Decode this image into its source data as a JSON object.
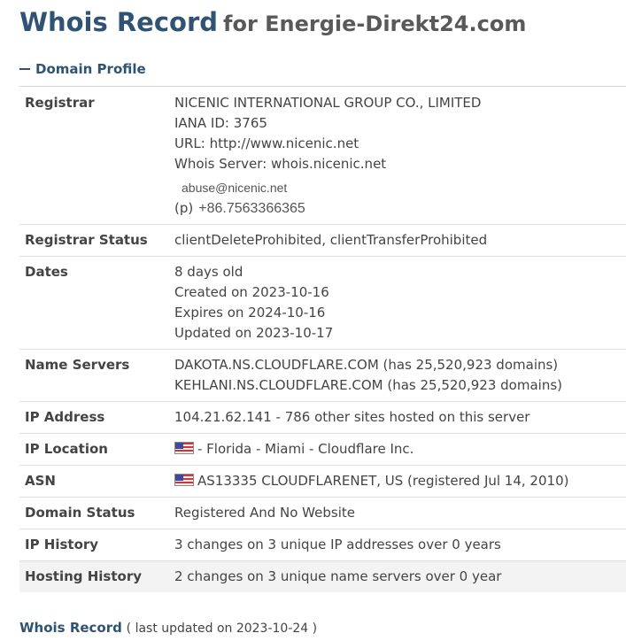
{
  "page": {
    "title_main": "Whois Record",
    "title_sub": "for Energie-Direkt24.com"
  },
  "section": {
    "label": "Domain Profile"
  },
  "registrar": {
    "label": "Registrar",
    "name": "NICENIC INTERNATIONAL GROUP CO., LIMITED",
    "iana": "IANA ID: 3765",
    "url": "URL: http://www.nicenic.net",
    "whois_server": "Whois Server: whois.nicenic.net",
    "email": "abuse@nicenic.net",
    "phone_prefix": "(p)",
    "phone": "+86.7563366365"
  },
  "registrar_status": {
    "label": "Registrar Status",
    "value": "clientDeleteProhibited, clientTransferProhibited"
  },
  "dates": {
    "label": "Dates",
    "age": "8 days old",
    "created": "Created on 2023-10-16",
    "expires": "Expires on 2024-10-16",
    "updated": "Updated on 2023-10-17"
  },
  "name_servers": {
    "label": "Name Servers",
    "ns1": "DAKOTA.NS.CLOUDFLARE.COM (has 25,520,923 domains)",
    "ns2": "KEHLANI.NS.CLOUDFLARE.COM (has 25,520,923 domains)"
  },
  "ip_address": {
    "label": "IP Address",
    "value": "104.21.62.141 - 786 other sites hosted on this server"
  },
  "ip_location": {
    "label": "IP Location",
    "flag_icon": "us-flag-icon",
    "value": "- Florida - Miami - Cloudflare Inc."
  },
  "asn": {
    "label": "ASN",
    "flag_icon": "us-flag-icon",
    "value": "AS13335 CLOUDFLARENET, US (registered Jul 14, 2010)"
  },
  "domain_status": {
    "label": "Domain Status",
    "value": "Registered And No Website"
  },
  "ip_history": {
    "label": "IP History",
    "value": "3 changes on 3 unique IP addresses over 0 years"
  },
  "hosting_history": {
    "label": "Hosting History",
    "value": "2 changes on 3 unique name servers over 0 year"
  },
  "footer": {
    "link": "Whois Record",
    "note": "( last updated on 2023-10-24 )"
  },
  "colors": {
    "title_blue": "#2f5373",
    "text": "#444444",
    "row_border": "#dddddd",
    "shaded_row": "#f3f3f3"
  }
}
